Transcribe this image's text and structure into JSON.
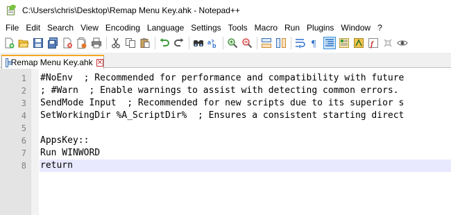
{
  "window": {
    "title": "C:\\Users\\chris\\Desktop\\Remap Menu Key.ahk - Notepad++"
  },
  "menu": [
    "File",
    "Edit",
    "Search",
    "View",
    "Encoding",
    "Language",
    "Settings",
    "Tools",
    "Macro",
    "Run",
    "Plugins",
    "Window",
    "?"
  ],
  "toolbar": {
    "icons": [
      "new-file-icon",
      "open-file-icon",
      "save-icon",
      "save-all-icon",
      "close-icon",
      "close-all-icon",
      "print-icon",
      "cut-icon",
      "copy-icon",
      "paste-icon",
      "undo-icon",
      "redo-icon",
      "find-icon",
      "replace-icon",
      "zoom-in-icon",
      "zoom-out-icon",
      "sync-vertical-icon",
      "sync-horizontal-icon",
      "word-wrap-icon",
      "show-all-characters-icon",
      "indent-guide-icon",
      "document-map-icon",
      "function-list-icon",
      "folder-as-workspace-icon",
      "monitoring-icon"
    ],
    "active_icon": "indent-guide-icon"
  },
  "tab": {
    "label": "Remap Menu Key.ahk",
    "close_glyph": "✕"
  },
  "editor": {
    "current_line": 8,
    "lines": [
      {
        "number": "1",
        "text": "#NoEnv  ; Recommended for performance and compatibility with future"
      },
      {
        "number": "2",
        "text": "; #Warn  ; Enable warnings to assist with detecting common errors."
      },
      {
        "number": "3",
        "text": "SendMode Input  ; Recommended for new scripts due to its superior s"
      },
      {
        "number": "4",
        "text": "SetWorkingDir %A_ScriptDir%  ; Ensures a consistent starting direct"
      },
      {
        "number": "5",
        "text": ""
      },
      {
        "number": "6",
        "text": "AppsKey::"
      },
      {
        "number": "7",
        "text": "Run WINWORD"
      },
      {
        "number": "8",
        "text": "return"
      }
    ]
  }
}
